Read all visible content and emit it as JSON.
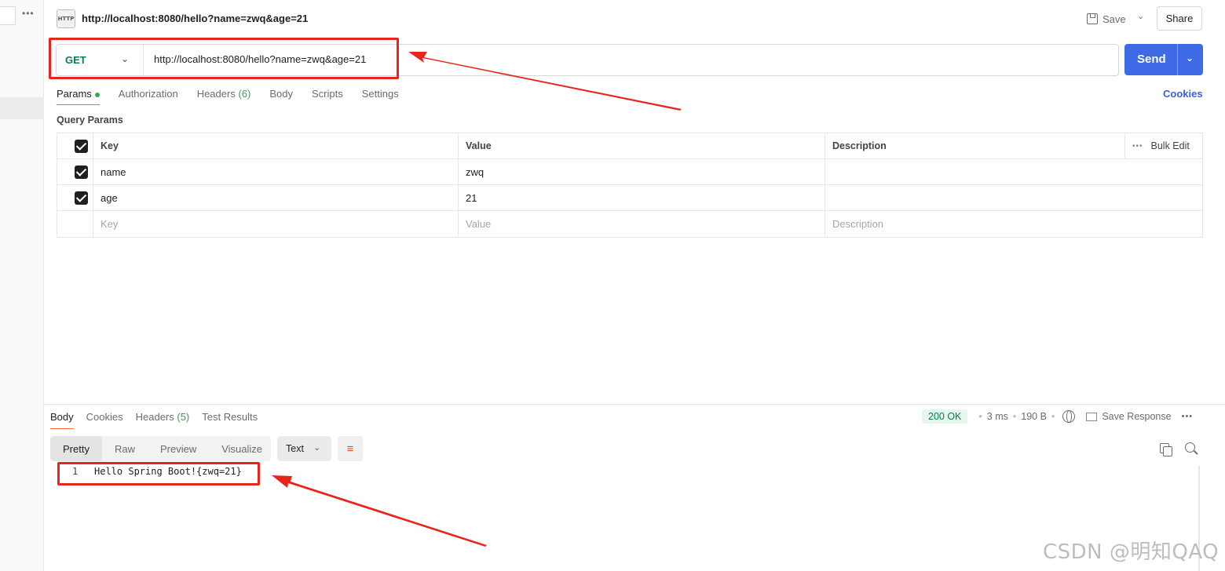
{
  "header": {
    "icon_label": "HTTP",
    "title": "http://localhost:8080/hello?name=zwq&age=21",
    "save_label": "Save",
    "share_label": "Share"
  },
  "request": {
    "method": "GET",
    "url": "http://localhost:8080/hello?name=zwq&age=21",
    "send_label": "Send"
  },
  "tabs": {
    "params": "Params",
    "authorization": "Authorization",
    "headers": "Headers",
    "headers_count": "(6)",
    "body": "Body",
    "scripts": "Scripts",
    "settings": "Settings",
    "cookies": "Cookies"
  },
  "query_params": {
    "title": "Query Params",
    "columns": {
      "key": "Key",
      "value": "Value",
      "description": "Description",
      "bulk_edit": "Bulk Edit"
    },
    "rows": [
      {
        "key": "name",
        "value": "zwq",
        "description": "",
        "checked": true
      },
      {
        "key": "age",
        "value": "21",
        "description": "",
        "checked": true
      }
    ],
    "placeholder": {
      "key": "Key",
      "value": "Value",
      "description": "Description"
    }
  },
  "response": {
    "tabs": {
      "body": "Body",
      "cookies": "Cookies",
      "headers": "Headers",
      "headers_count": "(5)",
      "test_results": "Test Results"
    },
    "status": "200 OK",
    "time": "3 ms",
    "size": "190 B",
    "save_response": "Save Response",
    "views": [
      "Pretty",
      "Raw",
      "Preview",
      "Visualize"
    ],
    "format": "Text",
    "lines": [
      {
        "no": "1",
        "text": "Hello Spring Boot!{zwq=21}"
      }
    ]
  },
  "watermark": "CSDN @明知QAQ",
  "colors": {
    "accent_send": "#3f6ae6",
    "method_get": "#0a7d4a",
    "active_tab_underline": "#ff6c37",
    "annotation_red": "#e8241c"
  }
}
